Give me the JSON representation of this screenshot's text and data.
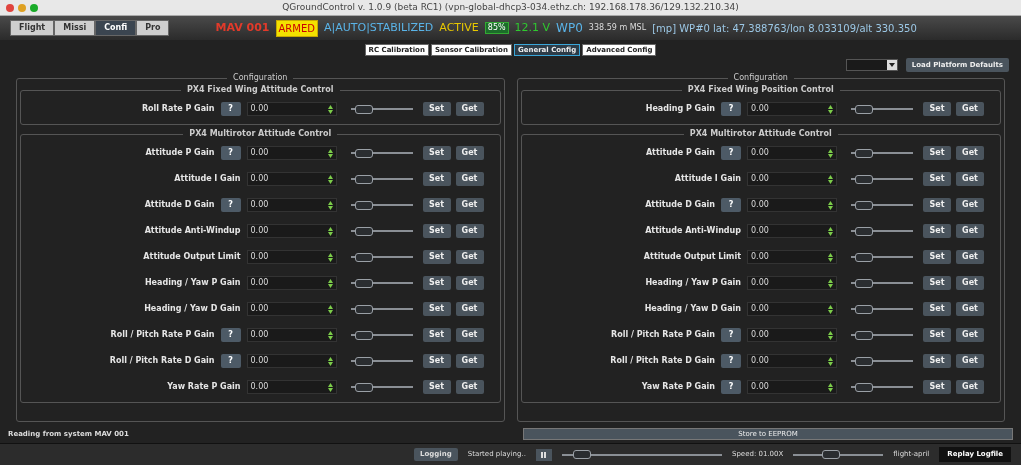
{
  "window": {
    "title": "QGroundControl v. 1.0.9 (beta RC1) (vpn-global-dhcp3-034.ethz.ch: 192.168.178.36/129.132.210.34)"
  },
  "toolbar": {
    "perspectives": [
      {
        "label": "Flight",
        "selected": false
      },
      {
        "label": "Missi",
        "selected": false
      },
      {
        "label": "Confi",
        "selected": true
      },
      {
        "label": "Pro",
        "selected": false
      }
    ],
    "system_name": "MAV 001",
    "armed": "ARMED",
    "mode": "A|AUTO|STABILIZED",
    "state": "ACTIVE",
    "battery": "85%",
    "voltage": "12.1 V",
    "waypoint": "WP0",
    "altitude": "338.59 m MSL",
    "position": "[mp] WP#0 lat: 47.388763/lon 8.033109/alt 330.350"
  },
  "tabs": [
    {
      "label": "RC Calibration",
      "selected": false
    },
    {
      "label": "Sensor Calibration",
      "selected": false
    },
    {
      "label": "General Config",
      "selected": true
    },
    {
      "label": "Advanced Config",
      "selected": false
    }
  ],
  "load_defaults_button": "Load Platform Defaults",
  "panels": [
    {
      "title": "Configuration",
      "groups": [
        {
          "title": "PX4 Fixed Wing Attitude Control",
          "params": [
            {
              "label": "Roll Rate P Gain",
              "help": "?",
              "value": "0.00",
              "level": 0.1,
              "set": "Set",
              "get": "Get"
            }
          ]
        },
        {
          "title": "PX4 Multirotor Attitude Control",
          "params": [
            {
              "label": "Attitude P Gain",
              "help": "?",
              "value": "0.00",
              "level": 0.1,
              "set": "Set",
              "get": "Get"
            },
            {
              "label": "Attitude I Gain",
              "value": "0.00",
              "level": 0.1,
              "set": "Set",
              "get": "Get"
            },
            {
              "label": "Attitude D Gain",
              "help": "?",
              "value": "0.00",
              "level": 0.1,
              "set": "Set",
              "get": "Get"
            },
            {
              "label": "Attitude Anti-Windup",
              "value": "0.00",
              "level": 0.1,
              "set": "Set",
              "get": "Get"
            },
            {
              "label": "Attitude Output Limit",
              "value": "0.00",
              "level": 0.1,
              "set": "Set",
              "get": "Get"
            },
            {
              "label": "Heading / Yaw P Gain",
              "value": "0.00",
              "level": 0.1,
              "set": "Set",
              "get": "Get"
            },
            {
              "label": "Heading / Yaw D Gain",
              "value": "0.00",
              "level": 0.1,
              "set": "Set",
              "get": "Get"
            },
            {
              "label": "Roll / Pitch Rate P Gain",
              "help": "?",
              "value": "0.00",
              "level": 0.1,
              "set": "Set",
              "get": "Get"
            },
            {
              "label": "Roll / Pitch Rate D Gain",
              "help": "?",
              "value": "0.00",
              "level": 0.1,
              "set": "Set",
              "get": "Get"
            },
            {
              "label": "Yaw Rate P Gain",
              "value": "0.00",
              "level": 0.1,
              "set": "Set",
              "get": "Get"
            }
          ]
        }
      ]
    },
    {
      "title": "Configuration",
      "groups": [
        {
          "title": "PX4 Fixed Wing Position Control",
          "params": [
            {
              "label": "Heading P Gain",
              "help": "?",
              "value": "0.00",
              "level": 0.1,
              "set": "Set",
              "get": "Get"
            }
          ]
        },
        {
          "title": "PX4 Multirotor Attitude Control",
          "params": [
            {
              "label": "Attitude P Gain",
              "help": "?",
              "value": "0.00",
              "level": 0.1,
              "set": "Set",
              "get": "Get"
            },
            {
              "label": "Attitude I Gain",
              "value": "0.00",
              "level": 0.1,
              "set": "Set",
              "get": "Get"
            },
            {
              "label": "Attitude D Gain",
              "help": "?",
              "value": "0.00",
              "level": 0.1,
              "set": "Set",
              "get": "Get"
            },
            {
              "label": "Attitude Anti-Windup",
              "value": "0.00",
              "level": 0.1,
              "set": "Set",
              "get": "Get"
            },
            {
              "label": "Attitude Output Limit",
              "value": "0.00",
              "level": 0.1,
              "set": "Set",
              "get": "Get"
            },
            {
              "label": "Heading / Yaw P Gain",
              "value": "0.00",
              "level": 0.1,
              "set": "Set",
              "get": "Get"
            },
            {
              "label": "Heading / Yaw D Gain",
              "value": "0.00",
              "level": 0.1,
              "set": "Set",
              "get": "Get"
            },
            {
              "label": "Roll / Pitch Rate P Gain",
              "help": "?",
              "value": "0.00",
              "level": 0.1,
              "set": "Set",
              "get": "Get"
            },
            {
              "label": "Roll / Pitch Rate D Gain",
              "help": "?",
              "value": "0.00",
              "level": 0.1,
              "set": "Set",
              "get": "Get"
            },
            {
              "label": "Yaw Rate P Gain",
              "help": "?",
              "value": "0.00",
              "level": 0.1,
              "set": "Set",
              "get": "Get"
            }
          ]
        }
      ]
    }
  ],
  "status": {
    "message": "Reading from system MAV 001",
    "store_button": "Store to EEPROM"
  },
  "log_bar": {
    "logging_button": "Logging",
    "playback_status": "Started playing..",
    "progress": {
      "level": 0.08
    },
    "speed": "Speed: 01.00X",
    "speed_slider": {
      "level": 0.4
    },
    "file": "flight-april",
    "replay_button": "Replay Logfile"
  }
}
